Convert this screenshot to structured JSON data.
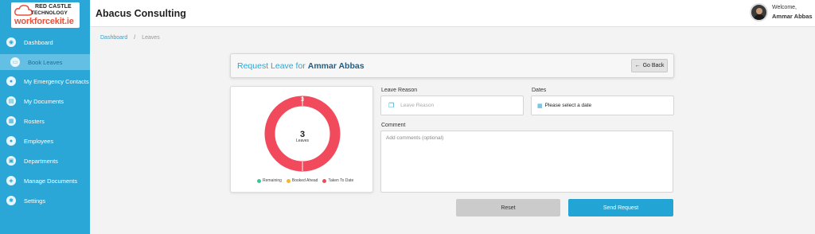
{
  "logo": {
    "line1": "RED CASTLE",
    "line2": "TECHNOLOGY",
    "line3": "workforcekit.ie"
  },
  "sidebar": {
    "items": [
      {
        "label": "Dashboard",
        "icon": "dashboard-icon",
        "active": false
      },
      {
        "label": "Book Leaves",
        "icon": "leave-icon",
        "active": true
      },
      {
        "label": "My Emergency Contacts",
        "icon": "contacts-icon",
        "active": false
      },
      {
        "label": "My Documents",
        "icon": "documents-icon",
        "active": false
      },
      {
        "label": "Rosters",
        "icon": "rosters-icon",
        "active": false
      },
      {
        "label": "Employees",
        "icon": "employees-icon",
        "active": false
      },
      {
        "label": "Departments",
        "icon": "departments-icon",
        "active": false
      },
      {
        "label": "Manage Documents",
        "icon": "manage-documents-icon",
        "active": false
      },
      {
        "label": "Settings",
        "icon": "settings-icon",
        "active": false
      }
    ]
  },
  "header": {
    "company": "Abacus Consulting",
    "welcome": "Welcome,",
    "user": "Ammar Abbas"
  },
  "breadcrumb": {
    "home": "Dashboard",
    "separator": "/",
    "current": "Leaves"
  },
  "request": {
    "title_prefix": "Request Leave for",
    "name": "Ammar Abbas",
    "go_back": "Go Back"
  },
  "chart_data": {
    "type": "pie",
    "center_value": "3",
    "center_label": "Leaves",
    "slice_label": "3",
    "series": [
      {
        "name": "Remaining",
        "value": 0,
        "color": "#2ecc8f"
      },
      {
        "name": "Booked Ahead",
        "value": 0,
        "color": "#f2b632"
      },
      {
        "name": "Taken To Date",
        "value": 3,
        "color": "#f24a5d"
      }
    ],
    "legend_placement": "bottom"
  },
  "form": {
    "leave_reason_label": "Leave Reason",
    "leave_reason_placeholder": "Leave Reason",
    "dates_label": "Dates",
    "dates_value": "Please select a date",
    "comment_label": "Comment",
    "comment_placeholder": "Add comments (optional)",
    "reset": "Reset",
    "send": "Send Request"
  },
  "colors": {
    "sidebar": "#2aa7d6",
    "accent": "#2aa7d6",
    "donut": "#f24a5d"
  }
}
